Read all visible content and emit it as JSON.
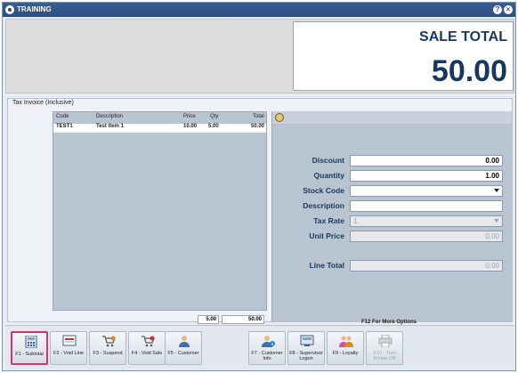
{
  "window": {
    "title": "TRAINING",
    "help_label": "?",
    "close_label": "×"
  },
  "sale": {
    "label": "SALE TOTAL",
    "value": "50.00"
  },
  "invoice": {
    "title": "Tax Invoice (Inclusive)",
    "headers": {
      "code": "Code",
      "description": "Description",
      "price": "Price",
      "qty": "Qty",
      "total": "Total"
    },
    "rows": [
      {
        "code": "TEST1",
        "description": "Test Item 1",
        "price": "10.00",
        "qty": "5.00",
        "total": "50.00"
      }
    ],
    "footer": {
      "qty_total": "5.00",
      "amount_total": "50.00"
    }
  },
  "fields": {
    "discount": {
      "label": "Discount",
      "value": "0.00"
    },
    "quantity": {
      "label": "Quantity",
      "value": "1.00"
    },
    "stock_code": {
      "label": "Stock Code",
      "value": ""
    },
    "description": {
      "label": "Description",
      "value": ""
    },
    "tax_rate": {
      "label": "Tax Rate",
      "value": "1"
    },
    "unit_price": {
      "label": "Unit Price",
      "value": "0.00"
    },
    "line_total": {
      "label": "Line Total",
      "value": "0.00"
    },
    "more_options": "F12 For More Options"
  },
  "buttons": [
    {
      "label": "F1 - Subtotal",
      "icon": "subtotal-icon"
    },
    {
      "label": "F2 - Void Line",
      "icon": "void-line-icon"
    },
    {
      "label": "F3 - Suspend",
      "icon": "suspend-cart-icon"
    },
    {
      "label": "F4 - Void Sale",
      "icon": "void-sale-cart-icon"
    },
    {
      "label": "F5 - Customer",
      "icon": "customer-icon"
    },
    {
      "label": "F7 - Customer Info",
      "icon": "customer-info-icon"
    },
    {
      "label": "F8 - Supervisor Logon",
      "icon": "supervisor-icon"
    },
    {
      "label": "F9 - Loyalty",
      "icon": "loyalty-icon"
    },
    {
      "label": "F10 - Turn Printer Off",
      "icon": "printer-icon"
    }
  ],
  "colors": {
    "title_bar": "#2c4e7f",
    "sale_text": "#17385e",
    "active_button_border": "#d6336c"
  }
}
